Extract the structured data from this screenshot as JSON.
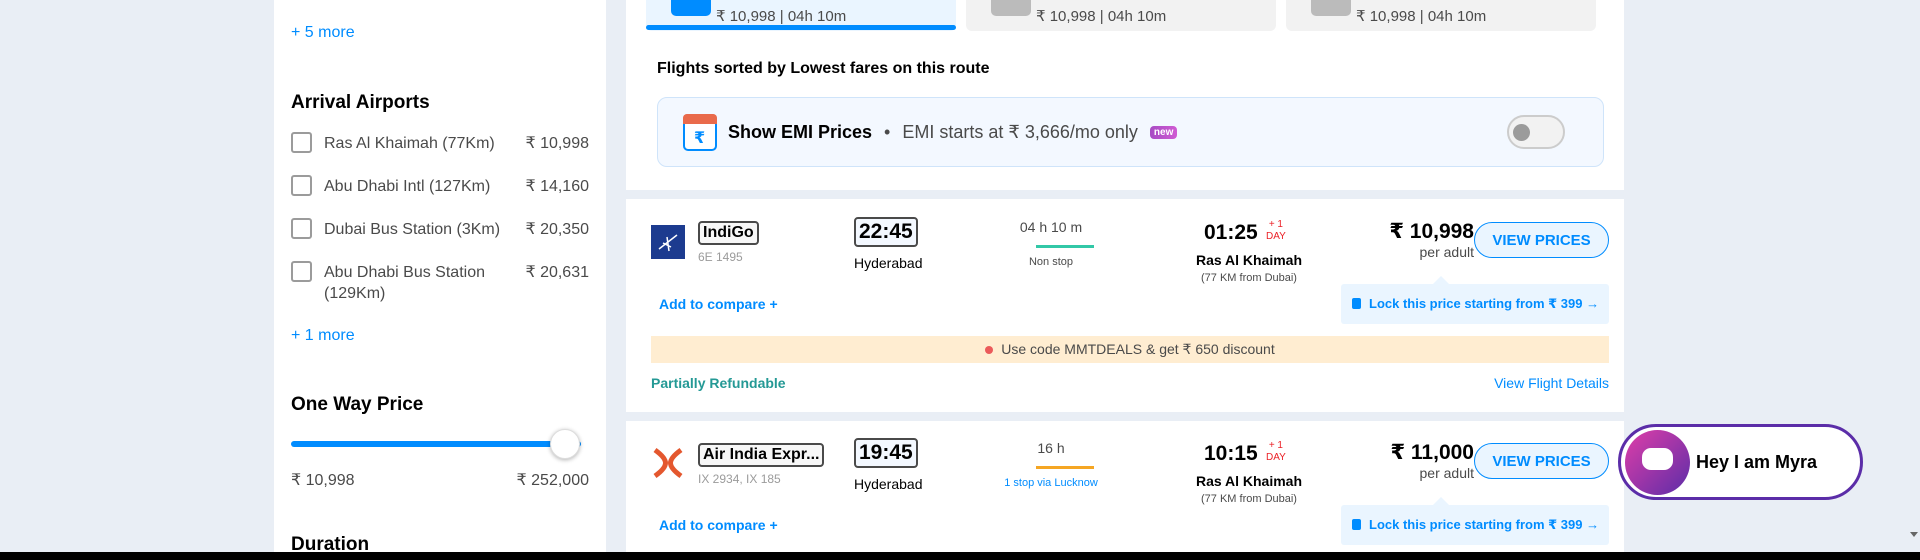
{
  "sidebar": {
    "more_top": "+ 5 more",
    "arrival_heading": "Arrival Airports",
    "airports": [
      {
        "name": "Ras Al Khaimah (77Km)",
        "price": "₹ 10,998"
      },
      {
        "name": "Abu Dhabi Intl (127Km)",
        "price": "₹ 14,160"
      },
      {
        "name": "Dubai Bus Station (3Km)",
        "price": "₹ 20,350"
      },
      {
        "name": "Abu Dhabi Bus Station (129Km)",
        "price": "₹ 20,631"
      }
    ],
    "more_bottom": "+ 1 more",
    "price_heading": "One Way Price",
    "price_min": "₹ 10,998",
    "price_max": "₹ 252,000",
    "price_slider_level": 1.0,
    "duration_heading": "Duration"
  },
  "sort_tabs": [
    {
      "info": "₹ 10,998 | 04h 10m",
      "active": true
    },
    {
      "info": "₹ 10,998 | 04h 10m",
      "active": false
    },
    {
      "info": "₹ 10,998 | 04h 10m",
      "active": false
    }
  ],
  "sorted_title": "Flights sorted by Lowest fares on this route",
  "emi": {
    "title": "Show EMI Prices",
    "separator": "•",
    "subtitle": "EMI starts at ₹ 3,666/mo only",
    "badge": "new",
    "calendar_symbol": "₹"
  },
  "flights": [
    {
      "airline": "IndiGo",
      "flight_no": "6E 1495",
      "dep_time": "22:45",
      "dep_city": "Hyderabad",
      "duration": "04 h 10 m",
      "stops": "Non stop",
      "arr_time": "01:25",
      "plus_day": "+ 1",
      "plus_day_label": "DAY",
      "arr_city": "Ras Al Khaimah",
      "arr_note": "(77 KM from Dubai)",
      "price": "₹ 10,998",
      "per_adult": "per adult",
      "view_label": "VIEW PRICES",
      "compare_label": "Add to compare  +",
      "lock_label": "Lock this price starting from ₹ 399  →",
      "promo": "Use code MMTDEALS & get ₹ 650 discount",
      "refund": "Partially Refundable",
      "details": "View Flight Details",
      "logo_color": "#1c3b8f",
      "line_color": "#32c8a7"
    },
    {
      "airline": "Air India Expr...",
      "flight_no": "IX 2934, IX 185",
      "dep_time": "19:45",
      "dep_city": "Hyderabad",
      "duration": "16 h",
      "stops": "1 stop via Lucknow",
      "arr_time": "10:15",
      "plus_day": "+ 1",
      "plus_day_label": "DAY",
      "arr_city": "Ras Al Khaimah",
      "arr_note": "(77 KM from Dubai)",
      "price": "₹ 11,000",
      "per_adult": "per adult",
      "view_label": "VIEW PRICES",
      "compare_label": "Add to compare  +",
      "lock_label": "Lock this price starting from ₹ 399  →",
      "logo_color": "#e4572e",
      "line_color": "#f5a623"
    }
  ],
  "myra": {
    "label": "Hey I am Myra"
  }
}
